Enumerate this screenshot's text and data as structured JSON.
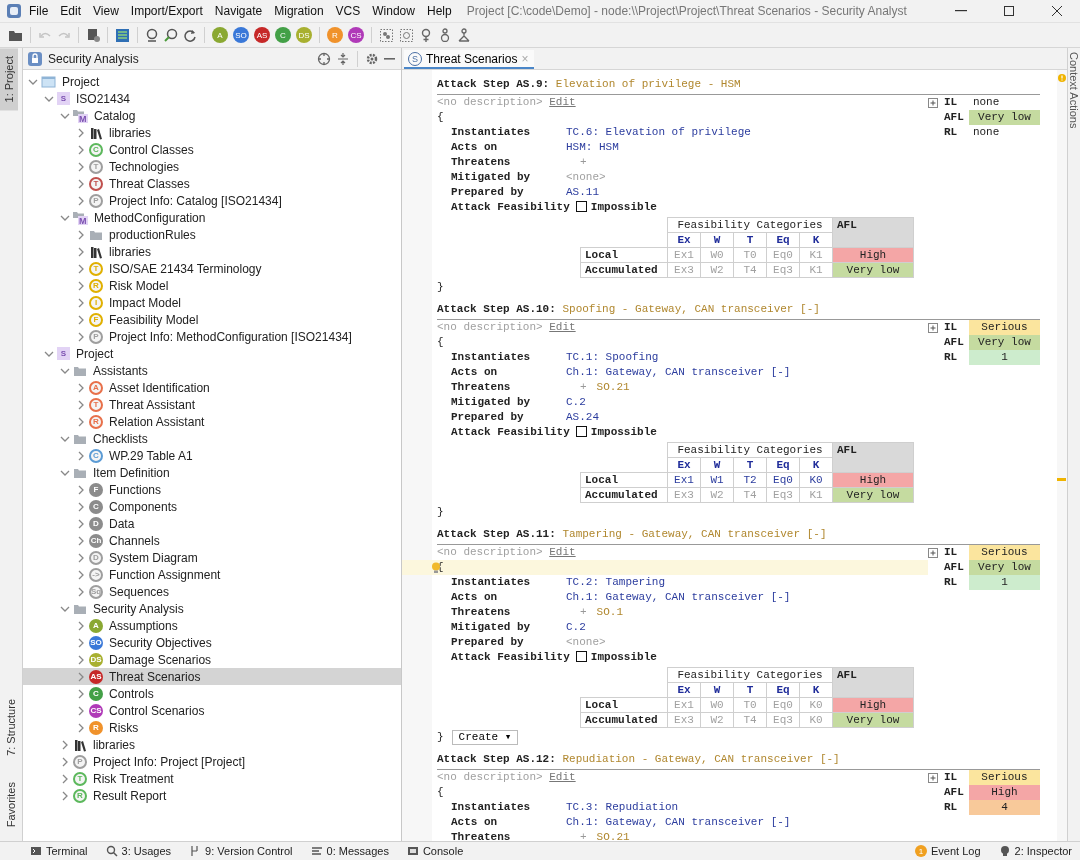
{
  "window": {
    "title": "Project [C:\\code\\Demo] - node:\\\\Project\\Project\\Threat Scenarios - Security Analyst"
  },
  "menu": [
    "File",
    "Edit",
    "View",
    "Import/Export",
    "Navigate",
    "Migration",
    "VCS",
    "Window",
    "Help"
  ],
  "toolbar": {
    "badge_groups": [
      [
        {
          "text": "A",
          "color": "#8aa832"
        },
        {
          "text": "SO",
          "color": "#3a78d8"
        },
        {
          "text": "AS",
          "color": "#c62828"
        },
        {
          "text": "C",
          "color": "#43a047"
        },
        {
          "text": "DS",
          "color": "#a8b030"
        }
      ],
      [
        {
          "text": "R",
          "color": "#f0922b"
        },
        {
          "text": "CS",
          "color": "#b03ab8"
        }
      ]
    ]
  },
  "side_tabs": {
    "left_top": [
      {
        "label": "1: Project",
        "selected": true
      }
    ],
    "left_bottom": [
      {
        "label": "7: Structure",
        "selected": false
      },
      {
        "label": "Favorites",
        "selected": false
      }
    ],
    "right": [
      {
        "label": "Context Actions"
      }
    ]
  },
  "project_panel": {
    "title": "Security Analysis",
    "tree": [
      {
        "label": "Project",
        "kind": "project",
        "expanded": true,
        "selected": false,
        "children": [
          {
            "label": "ISO21434",
            "kind": "solution",
            "badge": "S",
            "expanded": true,
            "selected": false,
            "children": [
              {
                "label": "Catalog",
                "kind": "model",
                "badge": "M",
                "expanded": true,
                "selected": false,
                "children": [
                  {
                    "label": "libraries",
                    "kind": "library",
                    "expanded": false,
                    "selected": false
                  },
                  {
                    "label": "Control Classes",
                    "kind": "badge",
                    "badge": "C",
                    "color": "#5cb85c",
                    "expanded": false,
                    "selected": false
                  },
                  {
                    "label": "Technologies",
                    "kind": "badge",
                    "badge": "T",
                    "color": "#9e9e9e",
                    "expanded": false,
                    "selected": false
                  },
                  {
                    "label": "Threat Classes",
                    "kind": "badge",
                    "badge": "T",
                    "color": "#c0504d",
                    "expanded": false,
                    "selected": false
                  },
                  {
                    "label": "Project Info: Catalog [ISO21434]",
                    "kind": "badge",
                    "badge": "P",
                    "color": "#9e9e9e",
                    "expanded": false,
                    "selected": false
                  }
                ]
              },
              {
                "label": "MethodConfiguration",
                "kind": "model",
                "badge": "M",
                "expanded": true,
                "selected": false,
                "children": [
                  {
                    "label": "productionRules",
                    "kind": "folder",
                    "expanded": false,
                    "selected": false
                  },
                  {
                    "label": "libraries",
                    "kind": "library",
                    "expanded": false,
                    "selected": false
                  },
                  {
                    "label": "ISO/SAE 21434 Terminology",
                    "kind": "badge",
                    "badge": "T",
                    "color": "#e0b000",
                    "expanded": false,
                    "selected": false
                  },
                  {
                    "label": "Risk Model",
                    "kind": "badge",
                    "badge": "R",
                    "color": "#e0b000",
                    "expanded": false,
                    "selected": false
                  },
                  {
                    "label": "Impact Model",
                    "kind": "badge",
                    "badge": "I",
                    "color": "#e0b000",
                    "expanded": false,
                    "selected": false
                  },
                  {
                    "label": "Feasibility Model",
                    "kind": "badge",
                    "badge": "F",
                    "color": "#e0b000",
                    "expanded": false,
                    "selected": false
                  },
                  {
                    "label": "Project Info: MethodConfiguration [ISO21434]",
                    "kind": "badge",
                    "badge": "P",
                    "color": "#9e9e9e",
                    "expanded": false,
                    "selected": false
                  }
                ]
              }
            ]
          },
          {
            "label": "Project",
            "kind": "solution",
            "badge": "S",
            "expanded": true,
            "selected": false,
            "children": [
              {
                "label": "Assistants",
                "kind": "folder",
                "expanded": true,
                "selected": false,
                "children": [
                  {
                    "label": "Asset Identification",
                    "kind": "badge",
                    "badge": "A",
                    "color": "#e8704a",
                    "expanded": false,
                    "selected": false
                  },
                  {
                    "label": "Threat Assistant",
                    "kind": "badge",
                    "badge": "T",
                    "color": "#e8704a",
                    "expanded": false,
                    "selected": false
                  },
                  {
                    "label": "Relation Assistant",
                    "kind": "badge",
                    "badge": "R",
                    "color": "#e8704a",
                    "expanded": false,
                    "selected": false
                  }
                ]
              },
              {
                "label": "Checklists",
                "kind": "folder",
                "expanded": true,
                "selected": false,
                "children": [
                  {
                    "label": "WP.29 Table A1",
                    "kind": "badge",
                    "badge": "C",
                    "color": "#5b9bd5",
                    "expanded": false,
                    "selected": false
                  }
                ]
              },
              {
                "label": "Item Definition",
                "kind": "folder",
                "expanded": true,
                "selected": false,
                "children": [
                  {
                    "label": "Functions",
                    "kind": "dot",
                    "badge": "F",
                    "color": "#8c8c8c",
                    "expanded": false,
                    "selected": false
                  },
                  {
                    "label": "Components",
                    "kind": "dot",
                    "badge": "C",
                    "color": "#8c8c8c",
                    "expanded": false,
                    "selected": false
                  },
                  {
                    "label": "Data",
                    "kind": "dot",
                    "badge": "D",
                    "color": "#8c8c8c",
                    "expanded": false,
                    "selected": false
                  },
                  {
                    "label": "Channels",
                    "kind": "dot",
                    "badge": "Ch",
                    "color": "#8c8c8c",
                    "expanded": false,
                    "selected": false
                  },
                  {
                    "label": "System Diagram",
                    "kind": "badge",
                    "badge": "D",
                    "color": "#9e9e9e",
                    "expanded": false,
                    "selected": false
                  },
                  {
                    "label": "Function Assignment",
                    "kind": "badge",
                    "badge": "->",
                    "color": "#9e9e9e",
                    "expanded": false,
                    "selected": false
                  },
                  {
                    "label": "Sequences",
                    "kind": "badge",
                    "badge": "Sq",
                    "color": "#9e9e9e",
                    "expanded": false,
                    "selected": false
                  }
                ]
              },
              {
                "label": "Security Analysis",
                "kind": "folder",
                "expanded": true,
                "selected": false,
                "children": [
                  {
                    "label": "Assumptions",
                    "kind": "dot",
                    "badge": "A",
                    "color": "#8aa832",
                    "expanded": false,
                    "selected": false
                  },
                  {
                    "label": "Security Objectives",
                    "kind": "dot",
                    "badge": "SO",
                    "color": "#3a78d8",
                    "expanded": false,
                    "selected": false
                  },
                  {
                    "label": "Damage Scenarios",
                    "kind": "dot",
                    "badge": "DS",
                    "color": "#a8b030",
                    "expanded": false,
                    "selected": false
                  },
                  {
                    "label": "Threat Scenarios",
                    "kind": "dot",
                    "badge": "AS",
                    "color": "#c62828",
                    "expanded": false,
                    "selected": true
                  },
                  {
                    "label": "Controls",
                    "kind": "dot",
                    "badge": "C",
                    "color": "#43a047",
                    "expanded": false,
                    "selected": false
                  },
                  {
                    "label": "Control Scenarios",
                    "kind": "dot",
                    "badge": "CS",
                    "color": "#b03ab8",
                    "expanded": false,
                    "selected": false
                  },
                  {
                    "label": "Risks",
                    "kind": "dot",
                    "badge": "R",
                    "color": "#f0922b",
                    "expanded": false,
                    "selected": false
                  }
                ]
              },
              {
                "label": "libraries",
                "kind": "library",
                "expanded": false,
                "selected": false
              },
              {
                "label": "Project Info: Project [Project]",
                "kind": "badge",
                "badge": "P",
                "color": "#9e9e9e",
                "expanded": false,
                "selected": false
              },
              {
                "label": "Risk Treatment",
                "kind": "badge",
                "badge": "T",
                "color": "#5cb85c",
                "expanded": false,
                "selected": false
              },
              {
                "label": "Result Report",
                "kind": "badge",
                "badge": "R",
                "color": "#5cb85c",
                "expanded": false,
                "selected": false
              }
            ]
          }
        ]
      }
    ]
  },
  "editor": {
    "tab": {
      "icon": "S",
      "label": "Threat Scenarios",
      "close": "×",
      "selected": true
    },
    "steps": [
      {
        "heading": "Attack Step AS.9:",
        "title": "Elevation of privilege - HSM",
        "description": "<no description>",
        "edit": "Edit",
        "open": "{",
        "brace_highlighted": false,
        "fields": [
          {
            "label": "Instantiates",
            "values": [
              {
                "text": "TC.6: Elevation of privilege",
                "kind": "link"
              }
            ]
          },
          {
            "label": "Acts on",
            "values": [
              {
                "text": "HSM: HSM",
                "kind": "link"
              }
            ]
          },
          {
            "label": "Threatens",
            "values": [
              {
                "text": "+",
                "kind": "plus"
              }
            ]
          },
          {
            "label": "Mitigated by",
            "values": [
              {
                "text": "<none>",
                "kind": "muted"
              }
            ]
          },
          {
            "label": "Prepared by",
            "values": [
              {
                "text": "AS.11",
                "kind": "link"
              }
            ]
          }
        ],
        "feasibility": {
          "label": "Attack Feasibility",
          "checked": false,
          "option": "Impossible"
        },
        "table": {
          "title": "Feasibility Categories",
          "afl_header": "AFL",
          "columns": [
            "Ex",
            "W",
            "T",
            "Eq",
            "K"
          ],
          "rows": [
            {
              "label": "Local",
              "cells": [
                {
                  "text": "Ex1",
                  "set": false
                },
                {
                  "text": "W0",
                  "set": false
                },
                {
                  "text": "T0",
                  "set": false
                },
                {
                  "text": "Eq0",
                  "set": false
                },
                {
                  "text": "K1",
                  "set": false
                }
              ],
              "afl": {
                "text": "High",
                "color": "#f4a6a6"
              }
            },
            {
              "label": "Accumulated",
              "cells": [
                {
                  "text": "Ex3",
                  "set": false
                },
                {
                  "text": "W2",
                  "set": false
                },
                {
                  "text": "T4",
                  "set": false
                },
                {
                  "text": "Eq3",
                  "set": false
                },
                {
                  "text": "K1",
                  "set": false
                }
              ],
              "afl": {
                "text": "Very low",
                "color": "#c5dba0"
              }
            }
          ]
        },
        "close": "}",
        "ratings": [
          {
            "label": "IL",
            "value": "none"
          },
          {
            "label": "AFL",
            "value": "Very low",
            "color": "#c5dba0"
          },
          {
            "label": "RL",
            "value": "none"
          }
        ]
      },
      {
        "heading": "Attack Step AS.10:",
        "title": "Spoofing - Gateway, CAN transceiver [-]",
        "description": "<no description>",
        "edit": "Edit",
        "open": "{",
        "brace_highlighted": false,
        "fields": [
          {
            "label": "Instantiates",
            "values": [
              {
                "text": "TC.1: Spoofing",
                "kind": "link"
              }
            ]
          },
          {
            "label": "Acts on",
            "values": [
              {
                "text": "Ch.1: Gateway, CAN transceiver [-]",
                "kind": "link"
              }
            ]
          },
          {
            "label": "Threatens",
            "values": [
              {
                "text": "+",
                "kind": "plus"
              },
              {
                "text": "SO.21",
                "kind": "ref"
              }
            ]
          },
          {
            "label": "Mitigated by",
            "values": [
              {
                "text": "C.2",
                "kind": "link"
              }
            ]
          },
          {
            "label": "Prepared by",
            "values": [
              {
                "text": "AS.24",
                "kind": "link"
              }
            ]
          }
        ],
        "feasibility": {
          "label": "Attack Feasibility",
          "checked": false,
          "option": "Impossible"
        },
        "table": {
          "title": "Feasibility Categories",
          "afl_header": "AFL",
          "columns": [
            "Ex",
            "W",
            "T",
            "Eq",
            "K"
          ],
          "rows": [
            {
              "label": "Local",
              "cells": [
                {
                  "text": "Ex1",
                  "set": true
                },
                {
                  "text": "W1",
                  "set": true
                },
                {
                  "text": "T2",
                  "set": true
                },
                {
                  "text": "Eq0",
                  "set": true
                },
                {
                  "text": "K0",
                  "set": true
                }
              ],
              "afl": {
                "text": "High",
                "color": "#f4a6a6"
              }
            },
            {
              "label": "Accumulated",
              "cells": [
                {
                  "text": "Ex3",
                  "set": false
                },
                {
                  "text": "W2",
                  "set": false
                },
                {
                  "text": "T4",
                  "set": false
                },
                {
                  "text": "Eq3",
                  "set": false
                },
                {
                  "text": "K1",
                  "set": false
                }
              ],
              "afl": {
                "text": "Very low",
                "color": "#c5dba0"
              }
            }
          ]
        },
        "close": "}",
        "ratings": [
          {
            "label": "IL",
            "value": "Serious",
            "color": "#fbe59e"
          },
          {
            "label": "AFL",
            "value": "Very low",
            "color": "#c5dba0"
          },
          {
            "label": "RL",
            "value": "1",
            "color": "#cdeccd"
          }
        ]
      },
      {
        "heading": "Attack Step AS.11:",
        "title": "Tampering - Gateway, CAN transceiver [-]",
        "description": "<no description>",
        "edit": "Edit",
        "open": "{",
        "brace_highlighted": true,
        "fields": [
          {
            "label": "Instantiates",
            "values": [
              {
                "text": "TC.2: Tampering",
                "kind": "link"
              }
            ]
          },
          {
            "label": "Acts on",
            "values": [
              {
                "text": "Ch.1: Gateway, CAN transceiver [-]",
                "kind": "link"
              }
            ]
          },
          {
            "label": "Threatens",
            "values": [
              {
                "text": "+",
                "kind": "plus"
              },
              {
                "text": "SO.1",
                "kind": "ref"
              }
            ]
          },
          {
            "label": "Mitigated by",
            "values": [
              {
                "text": "C.2",
                "kind": "link"
              }
            ]
          },
          {
            "label": "Prepared by",
            "values": [
              {
                "text": "<none>",
                "kind": "muted"
              }
            ]
          }
        ],
        "feasibility": {
          "label": "Attack Feasibility",
          "checked": false,
          "option": "Impossible"
        },
        "table": {
          "title": "Feasibility Categories",
          "afl_header": "AFL",
          "columns": [
            "Ex",
            "W",
            "T",
            "Eq",
            "K"
          ],
          "rows": [
            {
              "label": "Local",
              "cells": [
                {
                  "text": "Ex1",
                  "set": false
                },
                {
                  "text": "W0",
                  "set": false
                },
                {
                  "text": "T0",
                  "set": false
                },
                {
                  "text": "Eq0",
                  "set": false
                },
                {
                  "text": "K0",
                  "set": false
                }
              ],
              "afl": {
                "text": "High",
                "color": "#f4a6a6"
              }
            },
            {
              "label": "Accumulated",
              "cells": [
                {
                  "text": "Ex3",
                  "set": false
                },
                {
                  "text": "W2",
                  "set": false
                },
                {
                  "text": "T4",
                  "set": false
                },
                {
                  "text": "Eq3",
                  "set": false
                },
                {
                  "text": "K0",
                  "set": false
                }
              ],
              "afl": {
                "text": "Very low",
                "color": "#c5dba0"
              }
            }
          ]
        },
        "close": "}",
        "create": "Create ▾",
        "ratings": [
          {
            "label": "IL",
            "value": "Serious",
            "color": "#fbe59e"
          },
          {
            "label": "AFL",
            "value": "Very low",
            "color": "#c5dba0"
          },
          {
            "label": "RL",
            "value": "1",
            "color": "#cdeccd"
          }
        ]
      },
      {
        "heading": "Attack Step AS.12:",
        "title": "Repudiation - Gateway, CAN transceiver [-]",
        "description": "<no description>",
        "edit": "Edit",
        "open": "{",
        "brace_highlighted": false,
        "fields": [
          {
            "label": "Instantiates",
            "values": [
              {
                "text": "TC.3: Repudiation",
                "kind": "link"
              }
            ]
          },
          {
            "label": "Acts on",
            "values": [
              {
                "text": "Ch.1: Gateway, CAN transceiver [-]",
                "kind": "link"
              }
            ]
          },
          {
            "label": "Threatens",
            "values": [
              {
                "text": "+",
                "kind": "plus"
              },
              {
                "text": "SO.21",
                "kind": "ref"
              }
            ]
          }
        ],
        "ratings": [
          {
            "label": "IL",
            "value": "Serious",
            "color": "#fbe59e"
          },
          {
            "label": "AFL",
            "value": "High",
            "color": "#f4a6a6"
          },
          {
            "label": "RL",
            "value": "4",
            "color": "#f8c99a"
          }
        ]
      }
    ]
  },
  "status_bar": {
    "left": [
      {
        "label": "Terminal"
      },
      {
        "label": "3: Usages"
      },
      {
        "label": "9: Version Control"
      },
      {
        "label": "0: Messages"
      },
      {
        "label": "Console"
      }
    ],
    "right": [
      {
        "label": "Event Log",
        "badge": "1"
      },
      {
        "label": "2: Inspector"
      }
    ]
  }
}
